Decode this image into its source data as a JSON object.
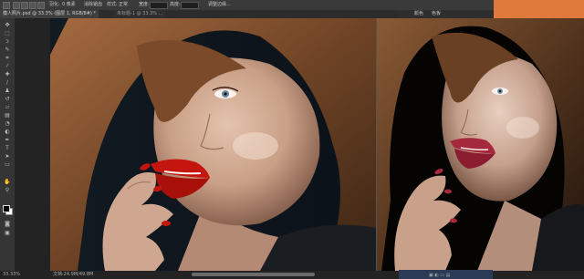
{
  "options_bar": {
    "labels": [
      "羽化:",
      "消除锯齿",
      "样式:",
      "正常",
      "宽度:",
      "高度:",
      "调整边缘..."
    ],
    "feather_value": "0 像素"
  },
  "tabs": [
    {
      "label": "模人照片.psd @ 33.3% (图层 1, RGB/8#) *"
    },
    {
      "label": "未标题-1 @ 33.3% ..."
    }
  ],
  "panel_tabs": [
    "颜色",
    "色板"
  ],
  "status_bar": {
    "zoom": "33.33%",
    "doc_info": "文档:24.9M/49.8M"
  },
  "tools": [
    "move-icon",
    "marquee-icon",
    "lasso-icon",
    "quick-select-icon",
    "crop-icon",
    "eyedropper-icon",
    "healing-icon",
    "brush-icon",
    "stamp-icon",
    "history-brush-icon",
    "eraser-icon",
    "gradient-icon",
    "blur-icon",
    "dodge-icon",
    "pen-icon",
    "type-icon",
    "path-select-icon",
    "shape-icon",
    "hand-icon",
    "zoom-icon"
  ],
  "colors": {
    "accent_orange": "#e07a3c",
    "lip_red": "#c4160e"
  }
}
